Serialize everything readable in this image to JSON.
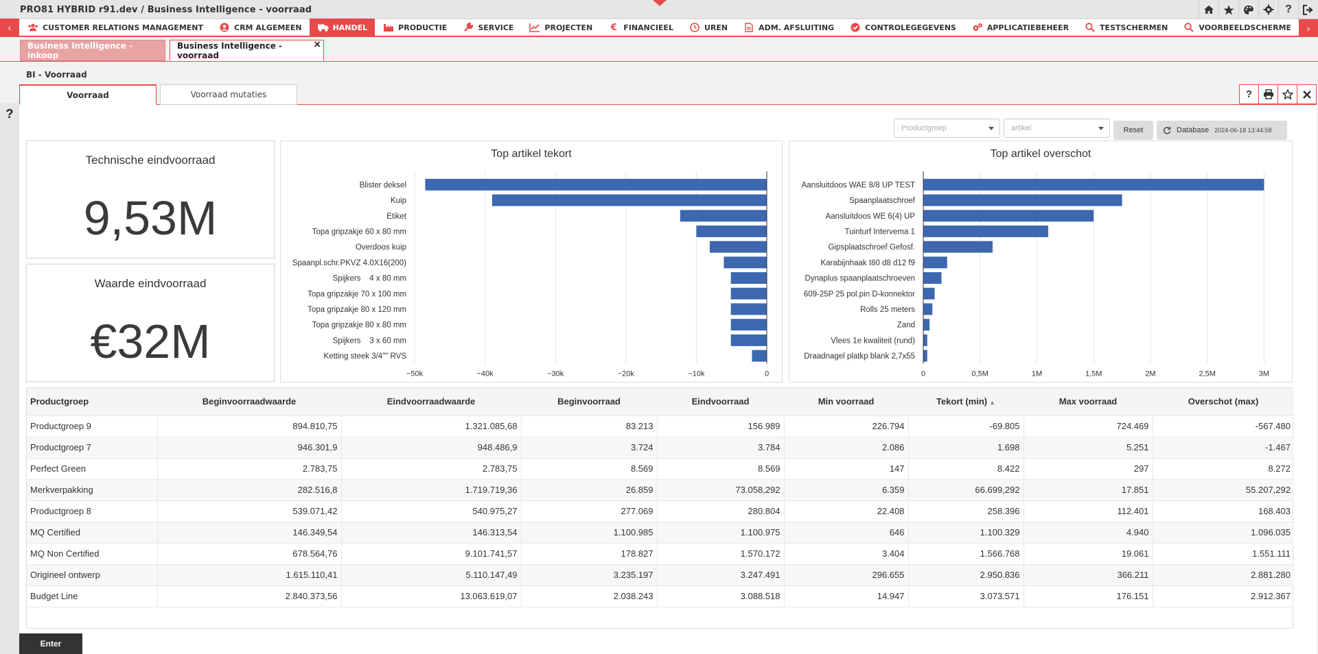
{
  "window": {
    "title": "PRO81 HYBRID r91.dev  /  Business Intelligence - voorraad"
  },
  "titlebar_icons": [
    "home-icon",
    "star-icon",
    "palette-icon",
    "gear-icon",
    "question-icon",
    "logout-icon"
  ],
  "menu": {
    "items": [
      {
        "label": "CUSTOMER RELATIONS MANAGEMENT",
        "icon": "users-icon",
        "active": false
      },
      {
        "label": "CRM ALGEMEEN",
        "icon": "user-circle-icon",
        "active": false
      },
      {
        "label": "HANDEL",
        "icon": "truck-icon",
        "active": true
      },
      {
        "label": "PRODUCTIE",
        "icon": "factory-icon",
        "active": false
      },
      {
        "label": "SERVICE",
        "icon": "wrench-icon",
        "active": false
      },
      {
        "label": "PROJECTEN",
        "icon": "chart-line-icon",
        "active": false
      },
      {
        "label": "FINANCIEEL",
        "icon": "euro-icon",
        "active": false
      },
      {
        "label": "UREN",
        "icon": "clock-icon",
        "active": false
      },
      {
        "label": "ADM. AFSLUITING",
        "icon": "document-icon",
        "active": false
      },
      {
        "label": "CONTROLEGEGEVENS",
        "icon": "check-circle-icon",
        "active": false
      },
      {
        "label": "APPLICATIEBEHEER",
        "icon": "cogs-icon",
        "active": false
      },
      {
        "label": "TESTSCHERMEN",
        "icon": "search-icon",
        "active": false
      },
      {
        "label": "VOORBEELDSCHERME",
        "icon": "search-icon",
        "active": false
      }
    ]
  },
  "doc_tabs": {
    "inactive": "Business Intelligence - inkoop",
    "active": "Business Intelligence - voorraad",
    "close": "×"
  },
  "page": {
    "title": "BI - Voorraad",
    "tabs": [
      "Voorraad",
      "Voorraad mutaties"
    ],
    "help": "?"
  },
  "filters": {
    "productgroep_placeholder": "Productgroep",
    "artikel_placeholder": "artikel",
    "reset_label": "Reset",
    "database_label": "Database",
    "database_timestamp": "2024-06-18 13:44:58"
  },
  "kpis": {
    "technische": {
      "title": "Technische eindvoorraad",
      "value": "9,53M"
    },
    "waarde": {
      "title": "Waarde eindvoorraad",
      "value": "€32M"
    }
  },
  "chart_data": [
    {
      "type": "bar",
      "orientation": "horizontal",
      "title": "Top artikel tekort",
      "categories": [
        "Blister deksel",
        "Kuip",
        "Etiket",
        "Topa gripzakje 60 x 80 mm",
        "Overdoos kuip",
        "Spaanpl.schr.PKVZ 4.0X16(200)",
        "Spijkers    4 x 80 mm",
        "Topa gripzakje 70 x 100 mm",
        "Topa gripzakje 80 x 120 mm",
        "Topa gripzakje 80 x 80 mm",
        "Spijkers    3 x 60 mm",
        "Ketting steek 3/4\"\" RVS"
      ],
      "values": [
        -48500,
        -39000,
        -12300,
        -10000,
        -8100,
        -6100,
        -5100,
        -5100,
        -5100,
        -5100,
        -5100,
        -2100
      ],
      "xlim": [
        -50000,
        0
      ],
      "ticks": [
        "−50k",
        "−40k",
        "−30k",
        "−20k",
        "−10k",
        "0"
      ],
      "tick_values": [
        -50000,
        -40000,
        -30000,
        -20000,
        -10000,
        0
      ],
      "color": "#3d68b0",
      "grid": true
    },
    {
      "type": "bar",
      "orientation": "horizontal",
      "title": "Top artikel overschot",
      "categories": [
        "Aansluitdoos WAE 8/8 UP TEST",
        "Spaanplaatschroef",
        "Aansluitdoos WE 6(4) UP",
        "Tuinturf Intervema 1",
        "Gipsplaatschroef Gefosf.",
        "Karabijnhaak I80 d8 d12 f9",
        "Dynaplus spaanplaatschroeven",
        "609-25P 25 pol.pin D-konnektor",
        "Rolls 25 meters",
        "Zand",
        "Vlees 1e kwaliteit (rund)",
        "Draadnagel platkp blank 2,7x55"
      ],
      "values": [
        3000000,
        1750000,
        1500000,
        1100000,
        610000,
        210000,
        160000,
        100000,
        80000,
        55000,
        35000,
        35000
      ],
      "xlim": [
        0,
        3100000
      ],
      "ticks": [
        "0",
        "0,5M",
        "1M",
        "1,5M",
        "2M",
        "2,5M",
        "3M"
      ],
      "tick_values": [
        0,
        500000,
        1000000,
        1500000,
        2000000,
        2500000,
        3000000
      ],
      "color": "#3d68b0",
      "grid": true
    }
  ],
  "table": {
    "headers": [
      "Productgroep",
      "Beginvoorraadwaarde",
      "Eindvoorraadwaarde",
      "Beginvoorraad",
      "Eindvoorraad",
      "Min voorraad",
      "Tekort (min)",
      "Max voorraad",
      "Overschot (max)"
    ],
    "sorted_column": "Tekort (min)",
    "sort_indicator": "▲",
    "rows": [
      [
        "Productgroep 9",
        "894.810,75",
        "1.321.085,68",
        "83.213",
        "156.989",
        "226.794",
        "-69.805",
        "724.469",
        "-567.480"
      ],
      [
        "Productgroep 7",
        "946.301,9",
        "948.486,9",
        "3.724",
        "3.784",
        "2.086",
        "1.698",
        "5.251",
        "-1.467"
      ],
      [
        "Perfect Green",
        "2.783,75",
        "2.783,75",
        "8.569",
        "8.569",
        "147",
        "8.422",
        "297",
        "8.272"
      ],
      [
        "Merkverpakking",
        "282.516,8",
        "1.719.719,36",
        "26.859",
        "73.058,292",
        "6.359",
        "66.699,292",
        "17.851",
        "55.207,292"
      ],
      [
        "Productgroep 8",
        "539.071,42",
        "540.975,27",
        "277.069",
        "280.804",
        "22.408",
        "258.396",
        "112.401",
        "168.403"
      ],
      [
        "MQ Certified",
        "146.349,54",
        "146.313,54",
        "1.100.985",
        "1.100.975",
        "646",
        "1.100.329",
        "4.940",
        "1.096.035"
      ],
      [
        "MQ Non Certified",
        "678.564,76",
        "9.101.741,57",
        "178.827",
        "1.570.172",
        "3.404",
        "1.566.768",
        "19.061",
        "1.551.111"
      ],
      [
        "Origineel ontwerp",
        "1.615.110,41",
        "5.110.147,49",
        "3.235.197",
        "3.247.491",
        "296.655",
        "2.950.836",
        "366.211",
        "2.881.280"
      ],
      [
        "Budget Line",
        "2.840.373,56",
        "13.063.619,07",
        "2.038.243",
        "3.088.518",
        "14.947",
        "3.073.571",
        "176.151",
        "2.912.367"
      ]
    ]
  },
  "footer": {
    "enter_label": "Enter"
  },
  "colors": {
    "accent": "#e84a4a",
    "bar": "#3d68b0"
  }
}
